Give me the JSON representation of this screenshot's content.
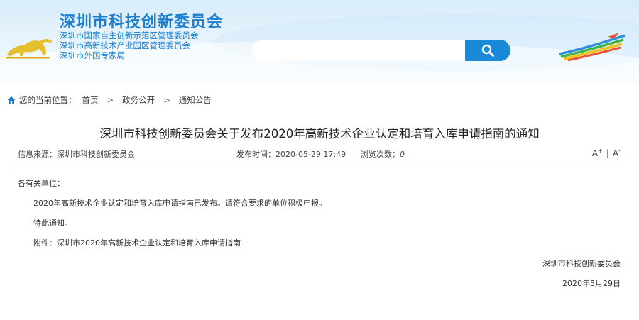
{
  "header": {
    "title": "深圳市科技创新委员会",
    "subtitles": [
      "深圳市国家自主创新示范区管理委员会",
      "深圳市高新技术产业园区管理委员会",
      "深圳市外国专家局"
    ],
    "search": {
      "value": "",
      "placeholder": ""
    },
    "icons": {
      "search": "search-icon",
      "logo_left": "bull-logo-icon",
      "logo_right": "rainbow-stripes-logo-icon"
    },
    "colors": {
      "brand": "#1f7fcf",
      "search_button": "#1a8ad8"
    }
  },
  "breadcrumb": {
    "label": "您的当前位置：",
    "items": [
      "首页",
      "政务公开",
      "通知公告"
    ],
    "separator": ">",
    "icon": "home-icon"
  },
  "article": {
    "title": "深圳市科技创新委员会关于发布2020年高新技术企业认定和培育入库申请指南的通知",
    "meta": {
      "source_label": "信息来源：",
      "source": "深圳市科技创新委员会",
      "time_label": "发布时间：",
      "time": "2020-05-29 17:49",
      "views_label": "浏览次数：",
      "views": "0"
    },
    "font_controls": {
      "larger": "A",
      "smaller": "A",
      "larger_mark": "+",
      "smaller_mark": "-",
      "divider": "|"
    },
    "greeting": "各有关单位：",
    "paragraphs": [
      "2020年高新技术企业认定和培育入库申请指南已发布。请符合要求的单位积极申报。",
      "特此通知。",
      "附件：深圳市2020年高新技术企业认定和培育入库申请指南"
    ],
    "signature": "深圳市科技创新委员会",
    "date": "2020年5月29日"
  }
}
